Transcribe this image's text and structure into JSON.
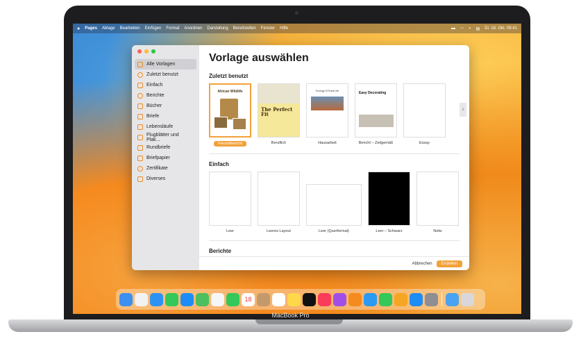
{
  "menubar": {
    "items": [
      "Pages",
      "Ablage",
      "Bearbeiten",
      "Einfügen",
      "Format",
      "Anordnen",
      "Darstellung",
      "Bereitstellen",
      "Fenster",
      "Hilfe"
    ],
    "clock": "Di. 18. Okt. 09:41"
  },
  "sidebar": {
    "items": [
      {
        "label": "Alle Vorlagen"
      },
      {
        "label": "Zuletzt benutzt"
      },
      {
        "label": "Einfach"
      },
      {
        "label": "Berichte"
      },
      {
        "label": "Bücher"
      },
      {
        "label": "Briefe"
      },
      {
        "label": "Lebensläufe"
      },
      {
        "label": "Flugblätter und Plak..."
      },
      {
        "label": "Rundbriefe"
      },
      {
        "label": "Briefpapier"
      },
      {
        "label": "Zertifikate"
      },
      {
        "label": "Diverses"
      }
    ]
  },
  "main": {
    "title": "Vorlage auswählen",
    "recent_title": "Zuletzt benutzt",
    "recent": [
      {
        "label": "Freizeitbericht",
        "heading": "African Wildlife"
      },
      {
        "label": "Beruflich",
        "heading": "The Perfect Fit"
      },
      {
        "label": "Hausarbeit",
        "heading": "Ecology Of Rural Life"
      },
      {
        "label": "Bericht – Zeitgemäß",
        "heading": "Easy Decorating"
      },
      {
        "label": "Essay",
        "heading": ""
      }
    ],
    "basic_title": "Einfach",
    "basic": [
      {
        "label": "Leer"
      },
      {
        "label": "Leeres Layout"
      },
      {
        "label": "Leer (Querformat)"
      },
      {
        "label": "Leer – Schwarz"
      },
      {
        "label": "Notiz"
      }
    ],
    "reports_title": "Berichte"
  },
  "footer": {
    "cancel": "Abbrechen",
    "create": "Erstellen"
  },
  "device": {
    "name": "MacBook Pro"
  },
  "colors": {
    "accent": "#f2a23a"
  }
}
